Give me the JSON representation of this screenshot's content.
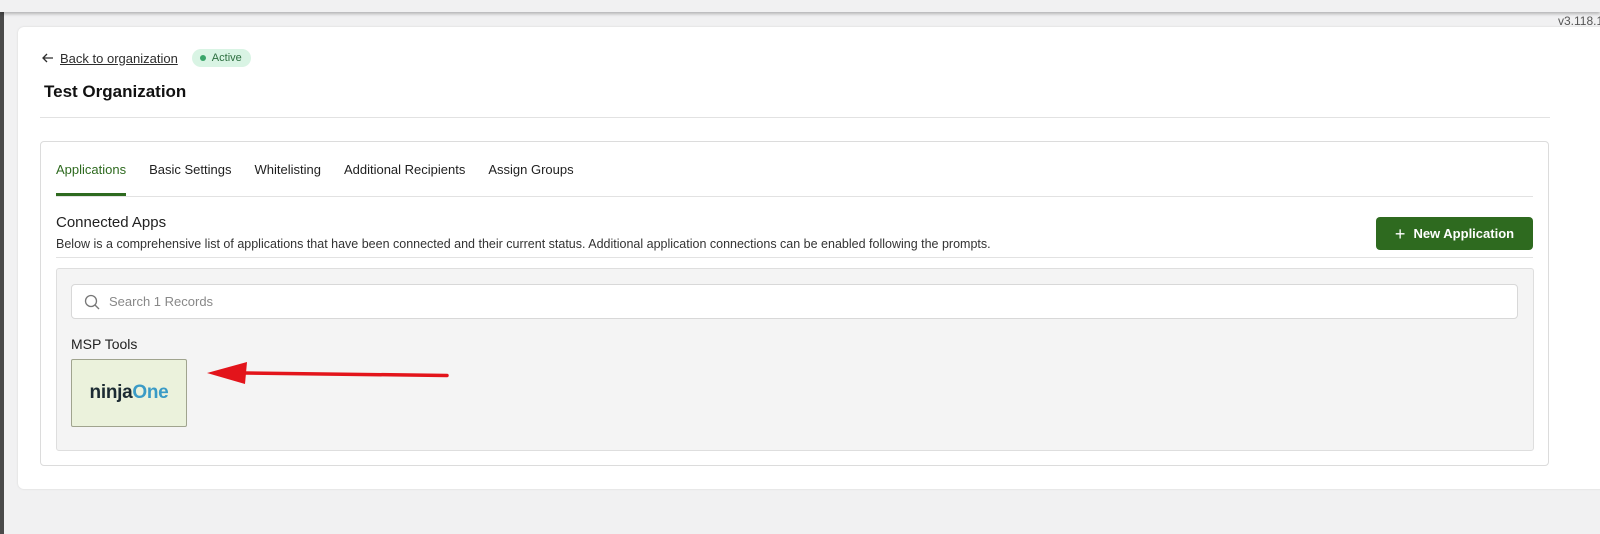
{
  "version": "v3.118.1",
  "back_link": {
    "label": "Back to organization"
  },
  "status": {
    "label": "Active",
    "color": "#3aa56a"
  },
  "page_title": "Test Organization",
  "tabs": [
    {
      "label": "Applications",
      "active": true
    },
    {
      "label": "Basic Settings",
      "active": false
    },
    {
      "label": "Whitelisting",
      "active": false
    },
    {
      "label": "Additional Recipients",
      "active": false
    },
    {
      "label": "Assign Groups",
      "active": false
    }
  ],
  "section": {
    "title": "Connected Apps",
    "description": "Below is a comprehensive list of applications that have been connected and their current status. Additional application connections can be enabled following the prompts."
  },
  "new_app_button": {
    "label": "New Application",
    "icon": "plus-icon"
  },
  "search": {
    "placeholder": "Search 1 Records",
    "value": "",
    "icon": "search-icon"
  },
  "groups": [
    {
      "title": "MSP Tools",
      "apps": [
        {
          "logo_part1": "ninja",
          "logo_part2": "One"
        }
      ]
    }
  ],
  "colors": {
    "accent": "#2e6a1f",
    "badge_bg": "#d9f4e4",
    "tile_bg": "#ebf2dc",
    "annotation_arrow": "#e3141b"
  }
}
